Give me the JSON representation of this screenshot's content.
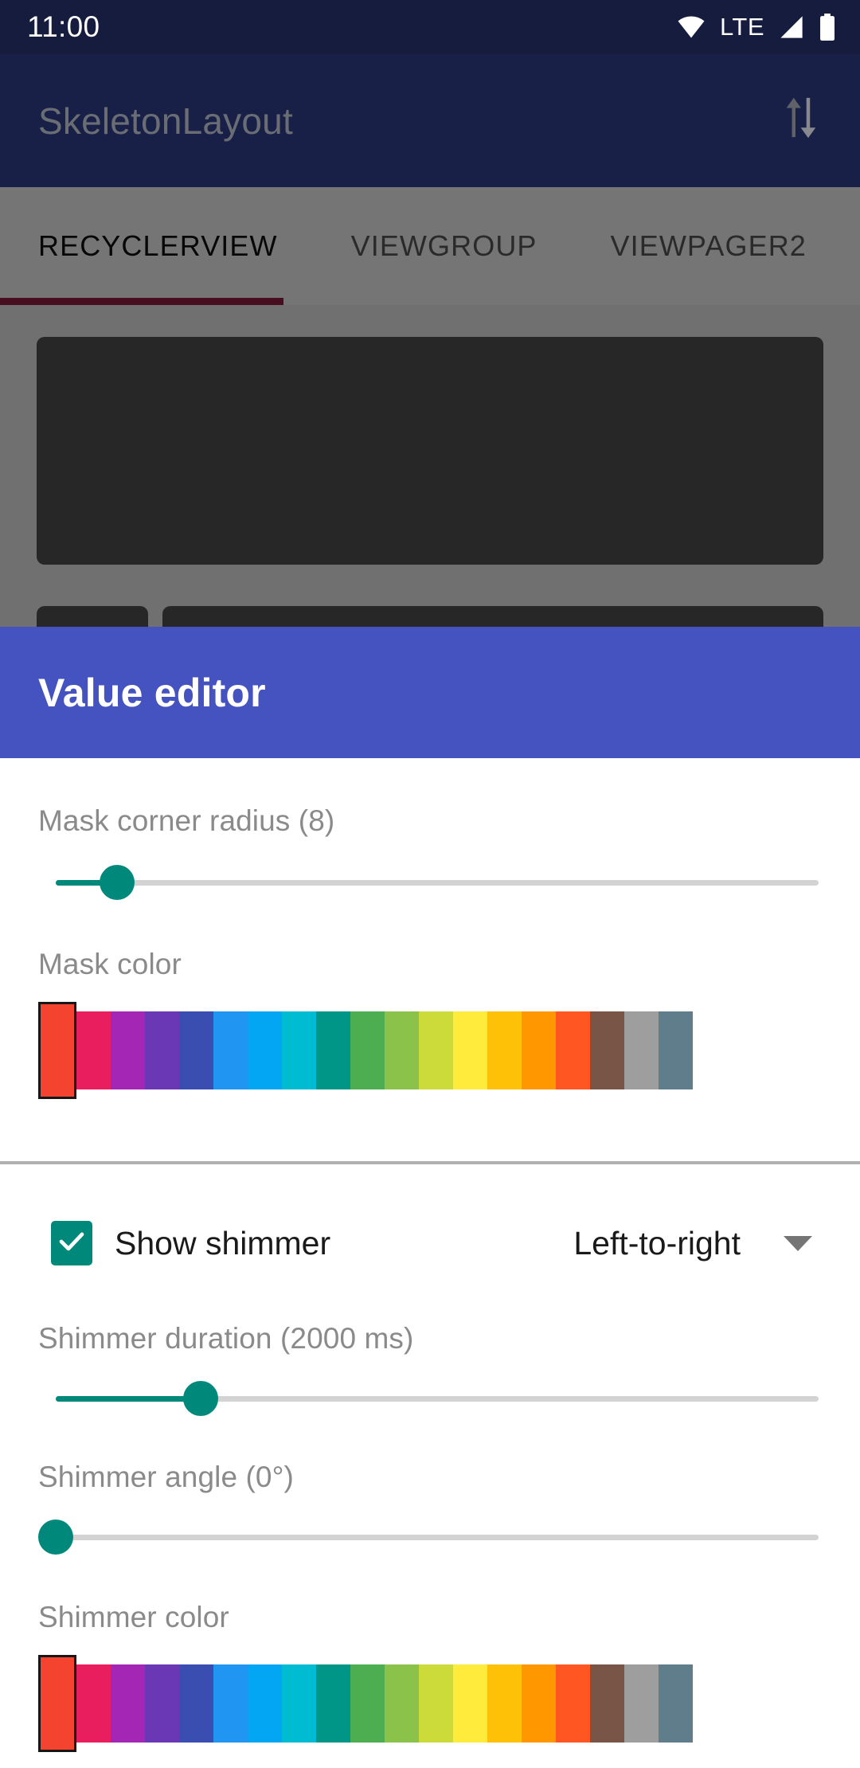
{
  "status_bar": {
    "clock": "11:00",
    "network_label": "LTE",
    "icons": [
      "wifi-icon",
      "lte-label",
      "cellular-signal-icon",
      "battery-icon"
    ]
  },
  "app_bar": {
    "title": "SkeletonLayout",
    "action_icon": "swap-vertical-icon"
  },
  "tabs": {
    "items": [
      {
        "label": "RECYCLERVIEW",
        "active": true
      },
      {
        "label": "VIEWGROUP",
        "active": false
      },
      {
        "label": "VIEWPAGER2",
        "active": false
      }
    ],
    "indicator_color": "#9c1f45"
  },
  "value_editor": {
    "title": "Value editor",
    "header_color": "#4453bf",
    "accent_color": "#00897b",
    "mask_corner_radius": {
      "label": "Mask corner radius (8)",
      "value": 8,
      "percent": 8
    },
    "mask_color": {
      "label": "Mask color",
      "selected_index": 0,
      "selected_color": "#f4432e"
    },
    "show_shimmer": {
      "label": "Show shimmer",
      "checked": true
    },
    "shimmer_direction": {
      "value": "Left-to-right",
      "caret_icon": "chevron-down-icon"
    },
    "shimmer_duration": {
      "label": "Shimmer duration (2000 ms)",
      "value": 2000,
      "percent": 19
    },
    "shimmer_angle": {
      "label": "Shimmer angle (0°)",
      "value": 0,
      "percent": 0
    },
    "shimmer_color": {
      "label": "Shimmer color",
      "selected_index": 0,
      "selected_color": "#f4432e"
    },
    "palette": [
      "#f4432e",
      "#e91e5e",
      "#a327b4",
      "#6a37b5",
      "#3a4db1",
      "#2096f2",
      "#03a6f2",
      "#00bcd3",
      "#009687",
      "#4cae50",
      "#8bc24a",
      "#ccdb39",
      "#ffeb3b",
      "#ffc107",
      "#ff9800",
      "#ff5622",
      "#795548",
      "#9e9e9e",
      "#607d8b"
    ]
  }
}
